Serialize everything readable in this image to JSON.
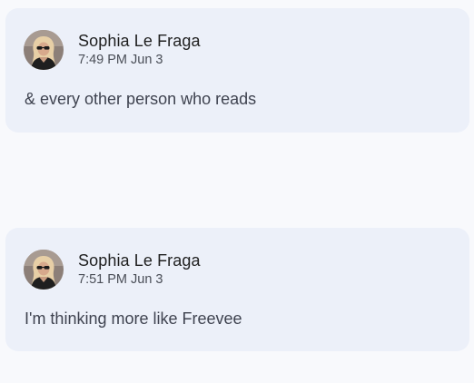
{
  "messages": [
    {
      "author": "Sophia Le Fraga",
      "timestamp": "7:49 PM Jun 3",
      "text": "& every other person who reads",
      "avatar_icon": "profile-photo"
    },
    {
      "author": "Sophia Le Fraga",
      "timestamp": "7:51 PM Jun 3",
      "text": "I'm thinking more like Freevee",
      "avatar_icon": "profile-photo"
    }
  ],
  "colors": {
    "page_background": "#f8f9fc",
    "card_background": "#ecf0f9",
    "author_text": "#1f1f1f",
    "meta_text": "#4a4e57",
    "body_text": "#3f4350"
  }
}
